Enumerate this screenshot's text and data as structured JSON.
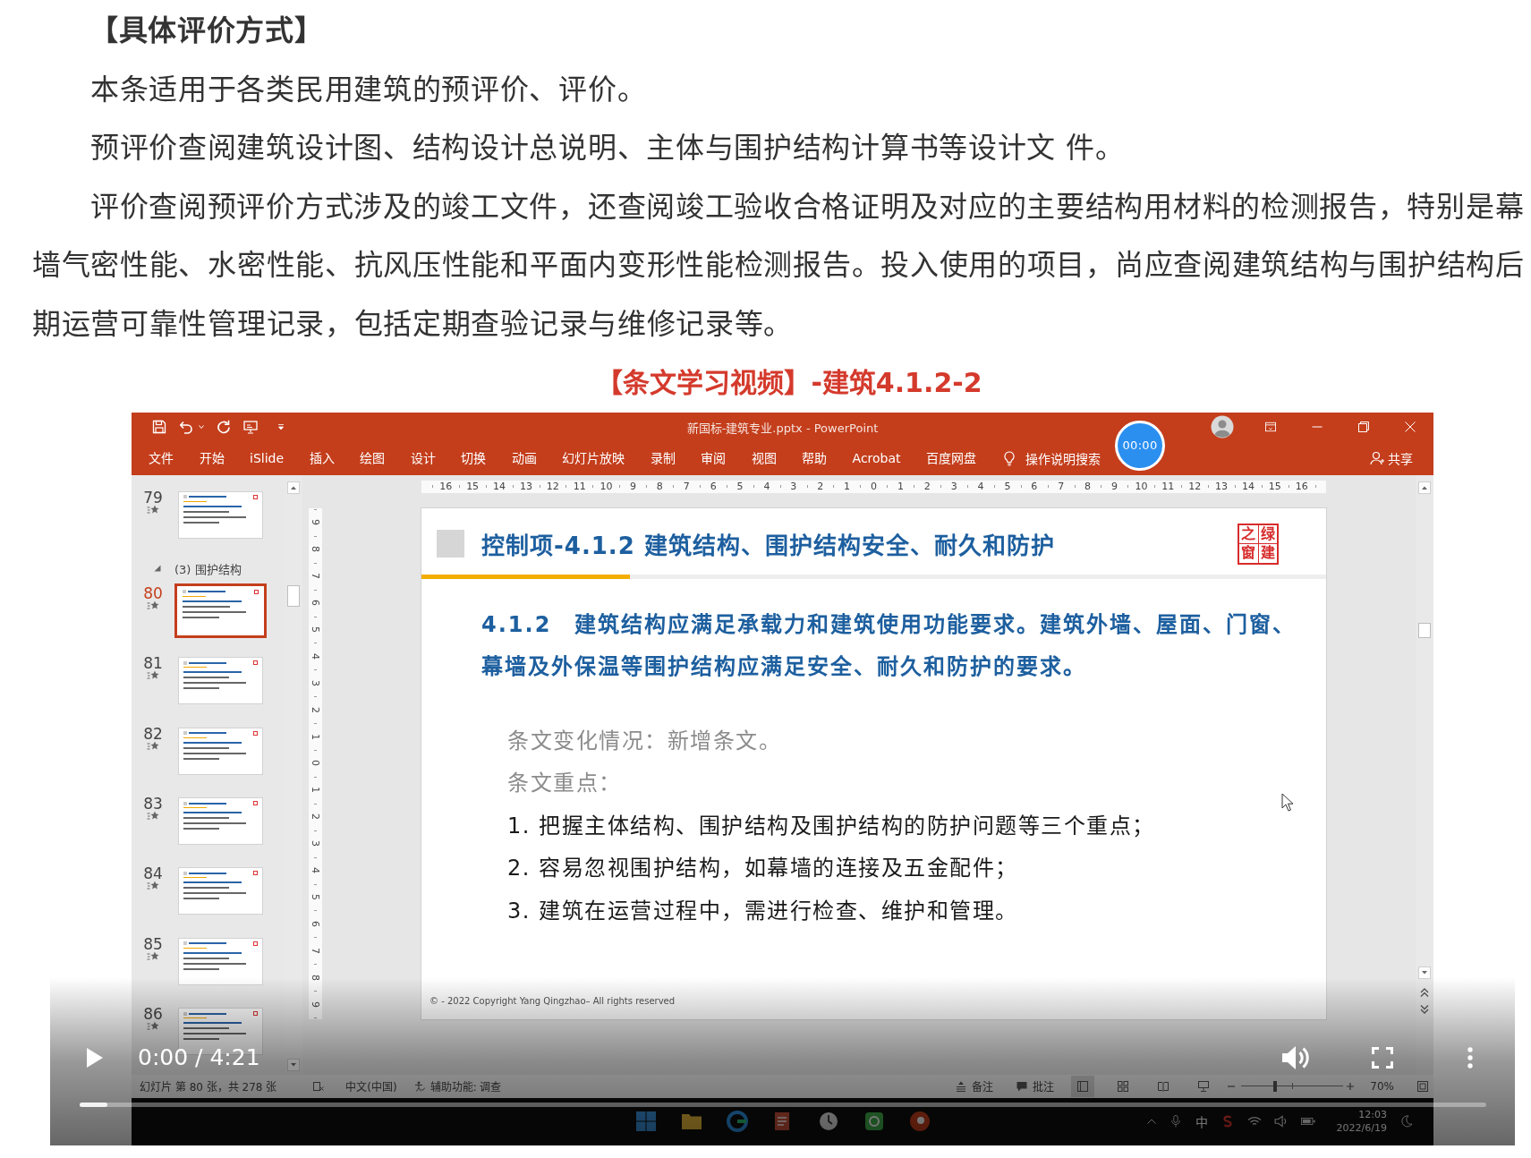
{
  "article": {
    "heading": "【具体评价方式】",
    "paragraphs": [
      "本条适用于各类民用建筑的预评价、评价。",
      "预评价查阅建筑设计图、结构设计总说明、主体与围护结构计算书等设计文 件。",
      "评价查阅预评价方式涉及的竣工文件，还查阅竣工验收合格证明及对应的主要结构用材料的检测报告，特别是幕墙气密性能、水密性能、抗风压性能和平面内变形性能检测报告。投入使用的项目，尚应查阅建筑结构与围护结构后期运营可靠性管理记录，包括定期查验记录与维修记录等。"
    ],
    "video_title": "【条文学习视频】-建筑4.1.2-2"
  },
  "video": {
    "window": {
      "title": "新国标-建筑专业.pptx - PowerPoint",
      "recording_timer": "00:00",
      "ribbon_tabs": [
        {
          "label": "文件",
          "selected": false
        },
        {
          "label": "开始",
          "selected": false
        },
        {
          "label": "iSlide",
          "selected": false
        },
        {
          "label": "插入",
          "selected": false
        },
        {
          "label": "绘图",
          "selected": false
        },
        {
          "label": "设计",
          "selected": false
        },
        {
          "label": "切换",
          "selected": false
        },
        {
          "label": "动画",
          "selected": false
        },
        {
          "label": "幻灯片放映",
          "selected": false
        },
        {
          "label": "录制",
          "selected": false
        },
        {
          "label": "审阅",
          "selected": false
        },
        {
          "label": "视图",
          "selected": false
        },
        {
          "label": "帮助",
          "selected": false
        },
        {
          "label": "Acrobat",
          "selected": false
        },
        {
          "label": "百度网盘",
          "selected": false
        }
      ],
      "tell_me": "操作说明搜索",
      "share": "共享"
    },
    "rulers": {
      "horizontal": [
        "16",
        "15",
        "14",
        "13",
        "12",
        "11",
        "10",
        "9",
        "8",
        "7",
        "6",
        "5",
        "4",
        "3",
        "2",
        "1",
        "0",
        "1",
        "2",
        "3",
        "4",
        "5",
        "6",
        "7",
        "8",
        "9",
        "10",
        "11",
        "12",
        "13",
        "14",
        "15",
        "16"
      ],
      "vertical": [
        "9",
        "8",
        "7",
        "6",
        "5",
        "4",
        "3",
        "2",
        "1",
        "0",
        "1",
        "2",
        "3",
        "4",
        "5",
        "6",
        "7",
        "8",
        "9"
      ]
    },
    "slides_panel": {
      "items": [
        {
          "kind": "slide",
          "number": "79",
          "selected": false
        },
        {
          "kind": "section",
          "label": "(3) 围护结构",
          "expanded": true
        },
        {
          "kind": "slide",
          "number": "80",
          "selected": true
        },
        {
          "kind": "slide",
          "number": "81",
          "selected": false
        },
        {
          "kind": "slide",
          "number": "82",
          "selected": false
        },
        {
          "kind": "slide",
          "number": "83",
          "selected": false
        },
        {
          "kind": "slide",
          "number": "84",
          "selected": false
        },
        {
          "kind": "slide",
          "number": "85",
          "selected": false
        },
        {
          "kind": "slide",
          "number": "86",
          "selected": false
        }
      ]
    },
    "slide": {
      "title": "控制项-4.1.2 建筑结构、围护结构安全、耐久和防护",
      "seal_columns": [
        "之窗",
        "绿建"
      ],
      "clause": "4.1.2　建筑结构应满足承载力和建筑使用功能要求。建筑外墙、屋面、门窗、幕墙及外保温等围护结构应满足安全、耐久和防护的要求。",
      "notes": [
        {
          "kind": "muted",
          "text": "条文变化情况：新增条文。"
        },
        {
          "kind": "muted",
          "text": "条文重点："
        },
        {
          "kind": "point",
          "text": "1. 把握主体结构、围护结构及围护结构的防护问题等三个重点；"
        },
        {
          "kind": "point",
          "text": "2. 容易忽视围护结构，如幕墙的连接及五金配件；"
        },
        {
          "kind": "point",
          "text": "3. 建筑在运营过程中，需进行检查、维护和管理。"
        }
      ],
      "footer": "© - 2022 Copyright Yang Qingzhao– All rights reserved"
    },
    "status_bar": {
      "slide_counter": "幻灯片 第 80 张，共 278 张",
      "language": "中文(中国)",
      "accessibility": "辅助功能: 调查",
      "notes": "备注",
      "comments": "批注",
      "views": [
        {
          "kind": "normal",
          "selected": true
        },
        {
          "kind": "sorter",
          "selected": false
        },
        {
          "kind": "reading",
          "selected": false
        },
        {
          "kind": "slideshow",
          "selected": false
        }
      ],
      "zoom": {
        "level": 0.33,
        "reading": "70%"
      }
    },
    "taskbar": {
      "input_method": "中",
      "time": "12:03",
      "date": "2022/6/19"
    },
    "player": {
      "playing": false,
      "time": "0:00 / 4:21",
      "progress": {
        "level": 0.02
      }
    }
  }
}
